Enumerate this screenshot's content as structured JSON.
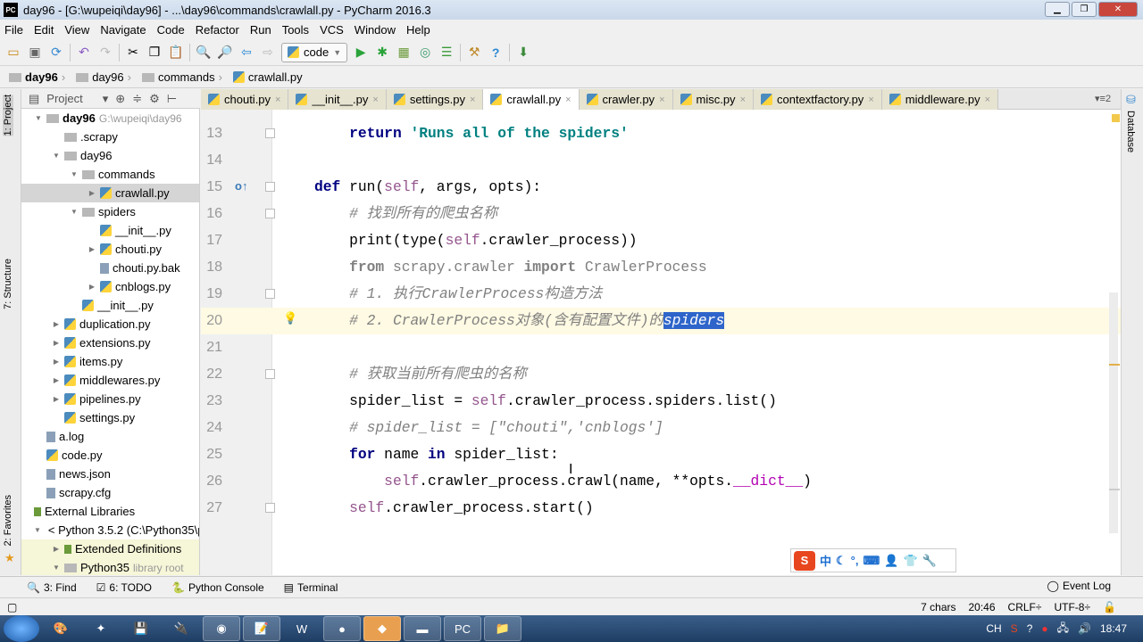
{
  "window": {
    "title": "day96 - [G:\\wupeiqi\\day96] - ...\\day96\\commands\\crawlall.py - PyCharm 2016.3",
    "app_icon": "PC"
  },
  "menu": [
    "File",
    "Edit",
    "View",
    "Navigate",
    "Code",
    "Refactor",
    "Run",
    "Tools",
    "VCS",
    "Window",
    "Help"
  ],
  "toolbar": {
    "run_config": "code"
  },
  "breadcrumb": [
    "day96",
    "day96",
    "commands",
    "crawlall.py"
  ],
  "side_tabs": {
    "project": "1: Project",
    "structure": "7: Structure",
    "favorites": "2: Favorites",
    "database": "Database"
  },
  "project_panel": {
    "title": "Project"
  },
  "tree": [
    {
      "label": "day96",
      "extra": "G:\\wupeiqi\\day96",
      "indent": 0,
      "arrow": "▼",
      "bold": true,
      "icon": "folder"
    },
    {
      "label": ".scrapy",
      "indent": 1,
      "arrow": "",
      "icon": "folder"
    },
    {
      "label": "day96",
      "indent": 1,
      "arrow": "▼",
      "icon": "folder"
    },
    {
      "label": "commands",
      "indent": 2,
      "arrow": "▼",
      "icon": "folder"
    },
    {
      "label": "crawlall.py",
      "indent": 3,
      "arrow": "▶",
      "icon": "python",
      "selected": true
    },
    {
      "label": "spiders",
      "indent": 2,
      "arrow": "▼",
      "icon": "folder"
    },
    {
      "label": "__init__.py",
      "indent": 3,
      "arrow": "",
      "icon": "python"
    },
    {
      "label": "chouti.py",
      "indent": 3,
      "arrow": "▶",
      "icon": "python"
    },
    {
      "label": "chouti.py.bak",
      "indent": 3,
      "arrow": "",
      "icon": "file"
    },
    {
      "label": "cnblogs.py",
      "indent": 3,
      "arrow": "▶",
      "icon": "python"
    },
    {
      "label": "__init__.py",
      "indent": 2,
      "arrow": "",
      "icon": "python"
    },
    {
      "label": "duplication.py",
      "indent": 1,
      "arrow": "▶",
      "icon": "python"
    },
    {
      "label": "extensions.py",
      "indent": 1,
      "arrow": "▶",
      "icon": "python"
    },
    {
      "label": "items.py",
      "indent": 1,
      "arrow": "▶",
      "icon": "python"
    },
    {
      "label": "middlewares.py",
      "indent": 1,
      "arrow": "▶",
      "icon": "python"
    },
    {
      "label": "pipelines.py",
      "indent": 1,
      "arrow": "▶",
      "icon": "python"
    },
    {
      "label": "settings.py",
      "indent": 1,
      "arrow": "",
      "icon": "python"
    },
    {
      "label": "a.log",
      "indent": 0,
      "arrow": "",
      "icon": "file"
    },
    {
      "label": "code.py",
      "indent": 0,
      "arrow": "",
      "icon": "python"
    },
    {
      "label": "news.json",
      "indent": 0,
      "arrow": "",
      "icon": "file"
    },
    {
      "label": "scrapy.cfg",
      "indent": 0,
      "arrow": "",
      "icon": "file"
    },
    {
      "label": "External Libraries",
      "indent": -1,
      "arrow": "",
      "icon": "library"
    },
    {
      "label": "< Python 3.5.2 (C:\\Python35\\p",
      "indent": 0,
      "arrow": "▼",
      "icon": "python"
    },
    {
      "label": "Extended Definitions",
      "indent": 1,
      "arrow": "▶",
      "icon": "library",
      "highlight": true
    },
    {
      "label": "Python35",
      "extra": "library root",
      "indent": 1,
      "arrow": "▼",
      "icon": "folder",
      "highlight": true
    }
  ],
  "tabs": [
    {
      "label": "chouti.py"
    },
    {
      "label": "__init__.py"
    },
    {
      "label": "settings.py"
    },
    {
      "label": "crawlall.py",
      "active": true
    },
    {
      "label": "crawler.py"
    },
    {
      "label": "misc.py"
    },
    {
      "label": "contextfactory.py"
    },
    {
      "label": "middleware.py"
    }
  ],
  "tabs_overflow": "▾≡2",
  "code_lines": [
    {
      "n": "13",
      "tokens": [
        [
          "    ",
          ""
        ],
        [
          "return",
          "kw"
        ],
        [
          " ",
          ""
        ],
        [
          "'Runs all of the spiders'",
          "str"
        ]
      ]
    },
    {
      "n": "14",
      "tokens": []
    },
    {
      "n": "15",
      "tokens": [
        [
          "def",
          "kw"
        ],
        [
          " run(",
          ""
        ],
        [
          "self",
          "self"
        ],
        [
          ", args, opts):",
          ""
        ]
      ]
    },
    {
      "n": "16",
      "tokens": [
        [
          "    ",
          ""
        ],
        [
          "# 找到所有的爬虫名称",
          "cm"
        ]
      ]
    },
    {
      "n": "17",
      "tokens": [
        [
          "    print(type(",
          ""
        ],
        [
          "self",
          "self"
        ],
        [
          ".crawler_process))",
          ""
        ]
      ]
    },
    {
      "n": "18",
      "tokens": [
        [
          "    ",
          ""
        ],
        [
          "from",
          "unkw"
        ],
        [
          " scrapy.crawler ",
          "un"
        ],
        [
          "import",
          "unkw"
        ],
        [
          " CrawlerProcess",
          "un"
        ]
      ]
    },
    {
      "n": "19",
      "tokens": [
        [
          "    ",
          ""
        ],
        [
          "# 1. 执行CrawlerProcess构造方法",
          "cm"
        ]
      ]
    },
    {
      "n": "20",
      "current": true,
      "tokens": [
        [
          "    ",
          ""
        ],
        [
          "# 2. CrawlerProcess对象(含有配置文件)的",
          "cm"
        ],
        [
          "spiders",
          "cm selx"
        ]
      ]
    },
    {
      "n": "21",
      "tokens": []
    },
    {
      "n": "22",
      "tokens": [
        [
          "    ",
          ""
        ],
        [
          "# 获取当前所有爬虫的名称",
          "cm"
        ]
      ]
    },
    {
      "n": "23",
      "tokens": [
        [
          "    spider_list = ",
          ""
        ],
        [
          "self",
          "self"
        ],
        [
          ".crawler_process.spiders.list()",
          ""
        ]
      ]
    },
    {
      "n": "24",
      "tokens": [
        [
          "    ",
          ""
        ],
        [
          "# spider_list = [\"chouti\",'cnblogs']",
          "cm"
        ]
      ]
    },
    {
      "n": "25",
      "tokens": [
        [
          "    ",
          ""
        ],
        [
          "for",
          "kw"
        ],
        [
          " name ",
          ""
        ],
        [
          "in",
          "kw"
        ],
        [
          " spider_list:",
          ""
        ]
      ]
    },
    {
      "n": "26",
      "tokens": [
        [
          "        ",
          ""
        ],
        [
          "self",
          "self"
        ],
        [
          ".crawler_process.crawl(name, **opts.",
          ""
        ],
        [
          "__dict__",
          "dn"
        ],
        [
          ")",
          ""
        ]
      ]
    },
    {
      "n": "27",
      "tokens": [
        [
          "    ",
          ""
        ],
        [
          "self",
          "self"
        ],
        [
          ".crawler_process.start()",
          ""
        ]
      ]
    }
  ],
  "ime": {
    "logo": "S",
    "mode": "中"
  },
  "toolwindows": [
    {
      "label": "3: Find",
      "icon": "search-icon"
    },
    {
      "label": "6: TODO",
      "icon": "todo-icon"
    },
    {
      "label": "Python Console",
      "icon": "python-console-icon"
    },
    {
      "label": "Terminal",
      "icon": "terminal-icon"
    }
  ],
  "event_log": "Event Log",
  "status": {
    "selection": "7 chars",
    "position": "20:46",
    "line_sep": "CRLF÷",
    "encoding": "UTF-8÷"
  },
  "taskbar": {
    "clock": "18:47",
    "lang": "CH"
  }
}
